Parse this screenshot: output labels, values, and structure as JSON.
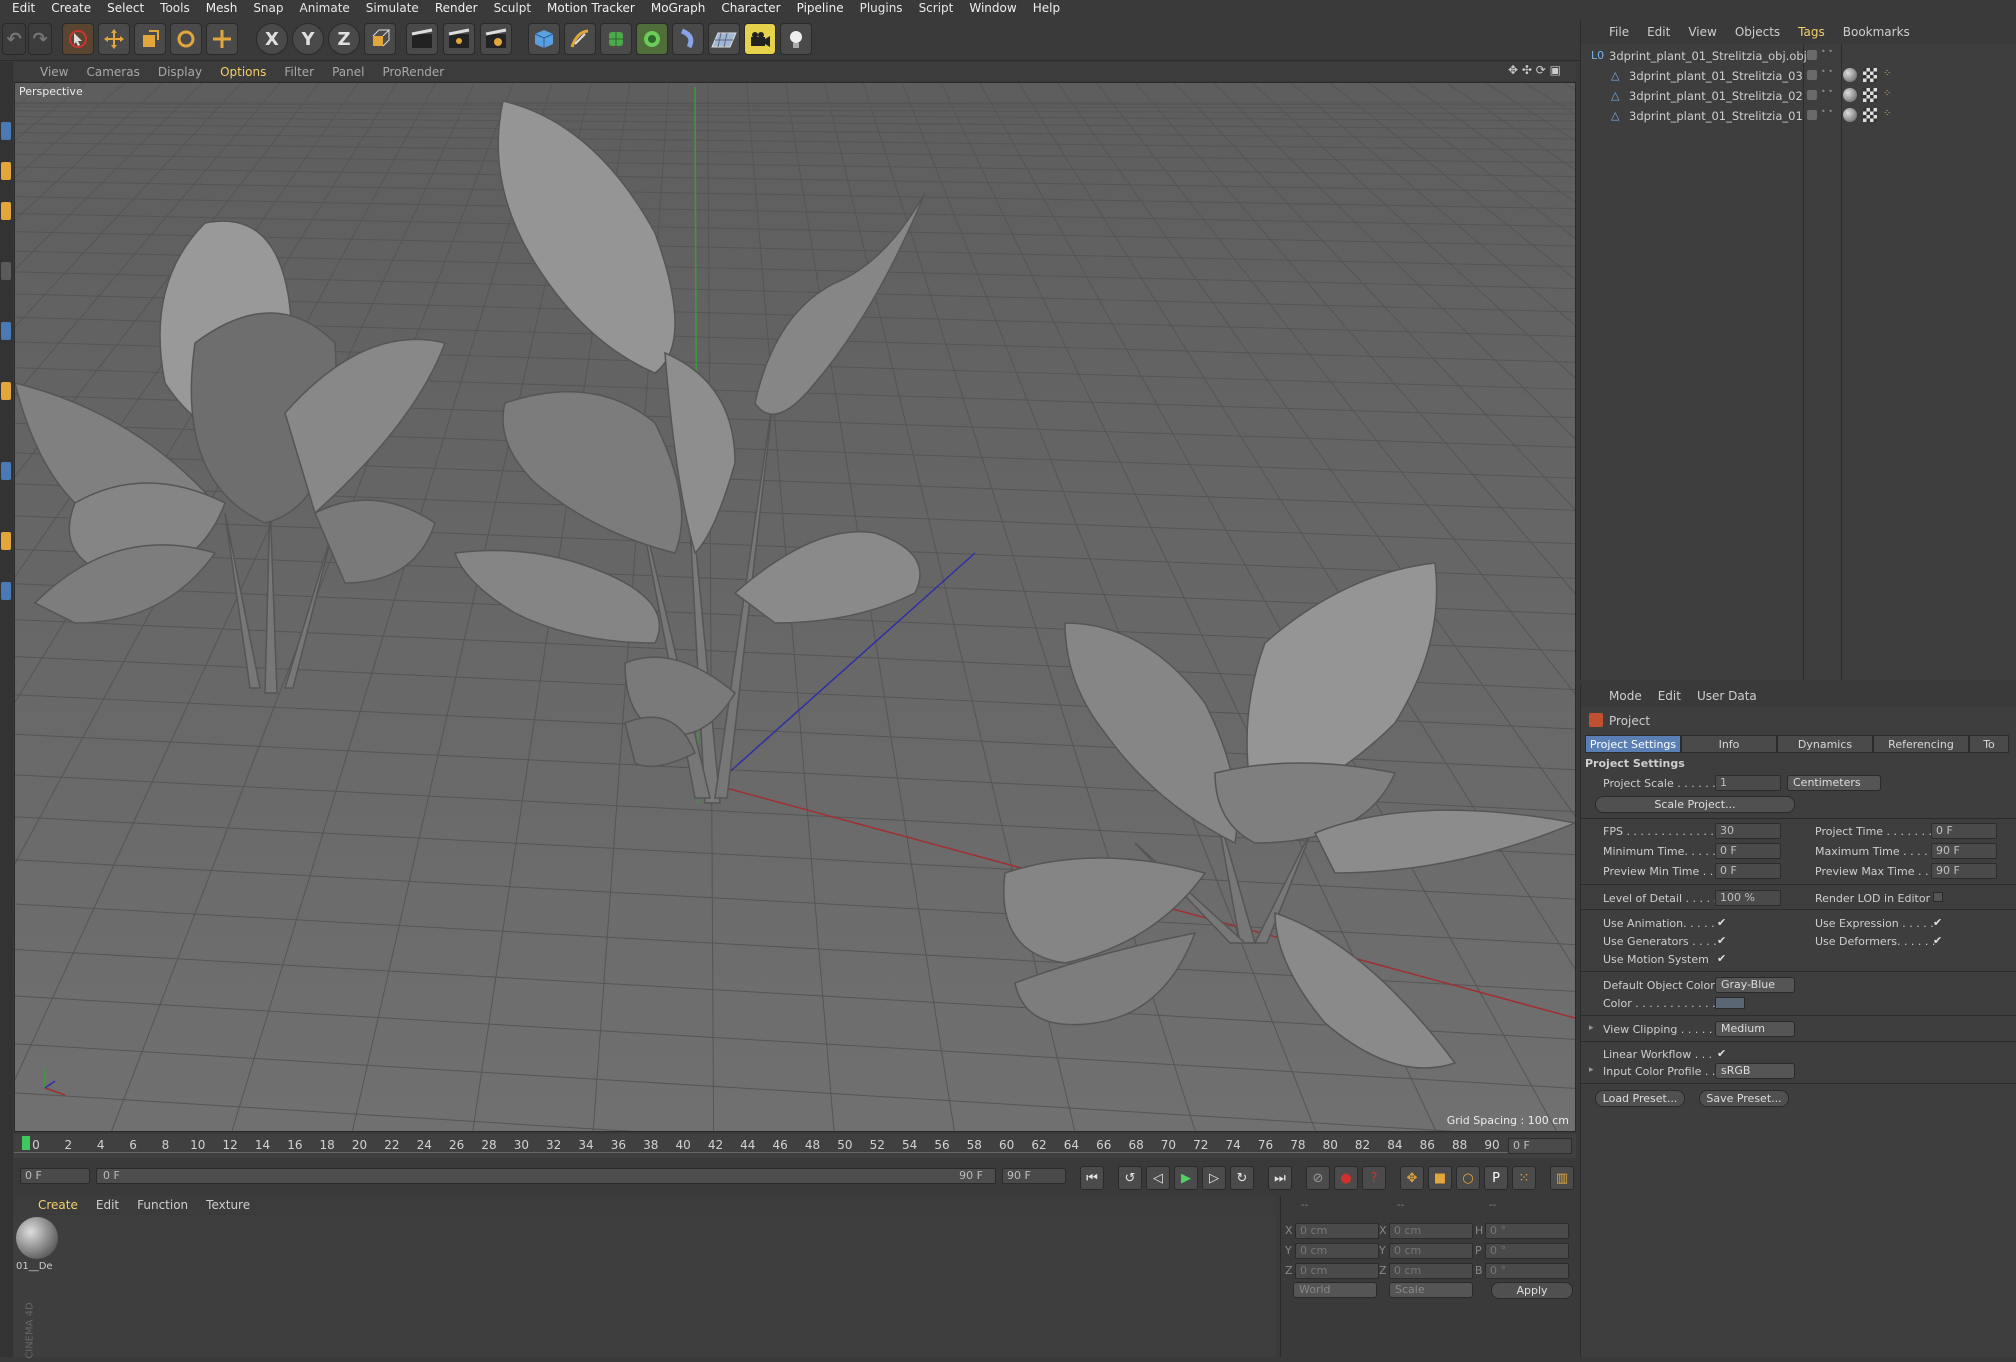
{
  "menubar": [
    "Edit",
    "Create",
    "Select",
    "Tools",
    "Mesh",
    "Snap",
    "Animate",
    "Simulate",
    "Render",
    "Sculpt",
    "Motion Tracker",
    "MoGraph",
    "Character",
    "Pipeline",
    "Plugins",
    "Script",
    "Window",
    "Help"
  ],
  "toolbar": {
    "axis_x": "X",
    "axis_y": "Y",
    "axis_z": "Z",
    "icons": [
      "undo-icon",
      "redo-icon",
      "select-arrow-icon",
      "move-icon",
      "scale-icon",
      "rotate-icon",
      "live-selection-icon",
      "x-axis-icon",
      "y-axis-icon",
      "z-axis-icon",
      "coordinate-system-icon",
      "render-view-icon",
      "render-picture-viewer-icon",
      "edit-render-settings-icon",
      "cube-icon",
      "pen-icon",
      "subdivision-icon",
      "cloner-icon",
      "deformer-icon",
      "floor-icon",
      "camera-icon",
      "light-icon"
    ]
  },
  "viewport": {
    "menu": [
      "View",
      "Cameras",
      "Display",
      "Options",
      "Filter",
      "Panel",
      "ProRender"
    ],
    "active_menu": "Options",
    "label": "Perspective",
    "grid_spacing": "Grid Spacing : 100 cm"
  },
  "timeline": {
    "ticks": [
      "0",
      "2",
      "4",
      "6",
      "8",
      "10",
      "12",
      "14",
      "16",
      "18",
      "20",
      "22",
      "24",
      "26",
      "28",
      "30",
      "32",
      "34",
      "36",
      "38",
      "40",
      "42",
      "44",
      "46",
      "48",
      "50",
      "52",
      "54",
      "56",
      "58",
      "60",
      "62",
      "64",
      "66",
      "68",
      "70",
      "72",
      "74",
      "76",
      "78",
      "80",
      "82",
      "84",
      "86",
      "88",
      "90"
    ],
    "current_frame": "0 F"
  },
  "transport": {
    "start_frame": "0 F",
    "range_start": "0 F",
    "range_end": "90 F",
    "end_frame": "90 F",
    "icons": [
      "go-to-start-icon",
      "previous-key-icon",
      "previous-frame-icon",
      "play-icon",
      "next-frame-icon",
      "next-key-icon",
      "go-to-end-icon",
      "record-icon",
      "autokey-icon",
      "keyframe-selection-icon",
      "move-key-icon",
      "scale-key-icon",
      "rotate-key-icon",
      "param-key-icon",
      "point-level-icon",
      "timeline-icon"
    ]
  },
  "material_manager": {
    "menu": [
      "Create",
      "Edit",
      "Function",
      "Texture"
    ],
    "active_menu": "Create",
    "materials": [
      {
        "name": "01__De"
      }
    ]
  },
  "coordinates": {
    "header": [
      "--",
      "--",
      "--"
    ],
    "rows": [
      {
        "a": "X",
        "a_val": "0 cm",
        "b": "X",
        "b_val": "0 cm",
        "c": "H",
        "c_val": "0 °"
      },
      {
        "a": "Y",
        "a_val": "0 cm",
        "b": "Y",
        "b_val": "0 cm",
        "c": "P",
        "c_val": "0 °"
      },
      {
        "a": "Z",
        "a_val": "0 cm",
        "b": "Z",
        "b_val": "0 cm",
        "c": "B",
        "c_val": "0 °"
      }
    ],
    "mode1": "World",
    "mode2": "Scale",
    "apply": "Apply"
  },
  "object_manager": {
    "menu": [
      "File",
      "Edit",
      "View",
      "Objects",
      "Tags",
      "Bookmarks"
    ],
    "active_menu": "Tags",
    "objects": [
      {
        "name": "3dprint_plant_01_Strelitzia_obj.obj",
        "level": 0,
        "has_tags": false
      },
      {
        "name": "3dprint_plant_01_Strelitzia_03",
        "level": 1,
        "has_tags": true
      },
      {
        "name": "3dprint_plant_01_Strelitzia_02",
        "level": 1,
        "has_tags": true
      },
      {
        "name": "3dprint_plant_01_Strelitzia_01",
        "level": 1,
        "has_tags": true
      }
    ]
  },
  "attributes": {
    "menu": [
      "Mode",
      "Edit",
      "User Data"
    ],
    "object": "Project",
    "tabs": [
      "Project Settings",
      "Info",
      "Dynamics",
      "Referencing",
      "To"
    ],
    "active_tab": "Project Settings",
    "section": "Project Settings",
    "project_scale_label": "Project Scale . . . . . .",
    "project_scale": "1",
    "scale_unit": "Centimeters",
    "scale_project": "Scale Project...",
    "fps_label": "FPS . . . . . . . . . . . . . .",
    "fps": "30",
    "project_time_label": "Project Time . . . . . . .",
    "project_time": "0 F",
    "min_time_label": "Minimum Time. . . . .",
    "min_time": "0 F",
    "max_time_label": "Maximum Time . . . .",
    "max_time": "90 F",
    "prev_min_label": "Preview Min Time . .",
    "prev_min": "0 F",
    "prev_max_label": "Preview Max Time . .",
    "prev_max": "90 F",
    "lod_label": "Level of Detail . . . . .",
    "lod": "100 %",
    "render_lod_label": "Render LOD in Editor",
    "use_animation": "Use Animation. . . . .",
    "use_expression": "Use Expression . . . . .",
    "use_generators": "Use Generators . . . .",
    "use_deformers": "Use Deformers. . . . . .",
    "use_motion": "Use Motion System",
    "default_color_label": "Default Object Color",
    "default_color": "Gray-Blue",
    "color_label": "Color . . . . . . . . . . . .",
    "view_clipping_label": "View Clipping . . . . . .",
    "view_clipping": "Medium",
    "linear_workflow": "Linear Workflow . . .",
    "input_color_label": "Input Color Profile . .",
    "input_color": "sRGB",
    "load_preset": "Load Preset...",
    "save_preset": "Save Preset...",
    "check": "✔"
  },
  "colors": {
    "accent": "#f3cf6a",
    "tab_active": "#5a7fb5",
    "viewport_bg": "#6b6b6b"
  }
}
